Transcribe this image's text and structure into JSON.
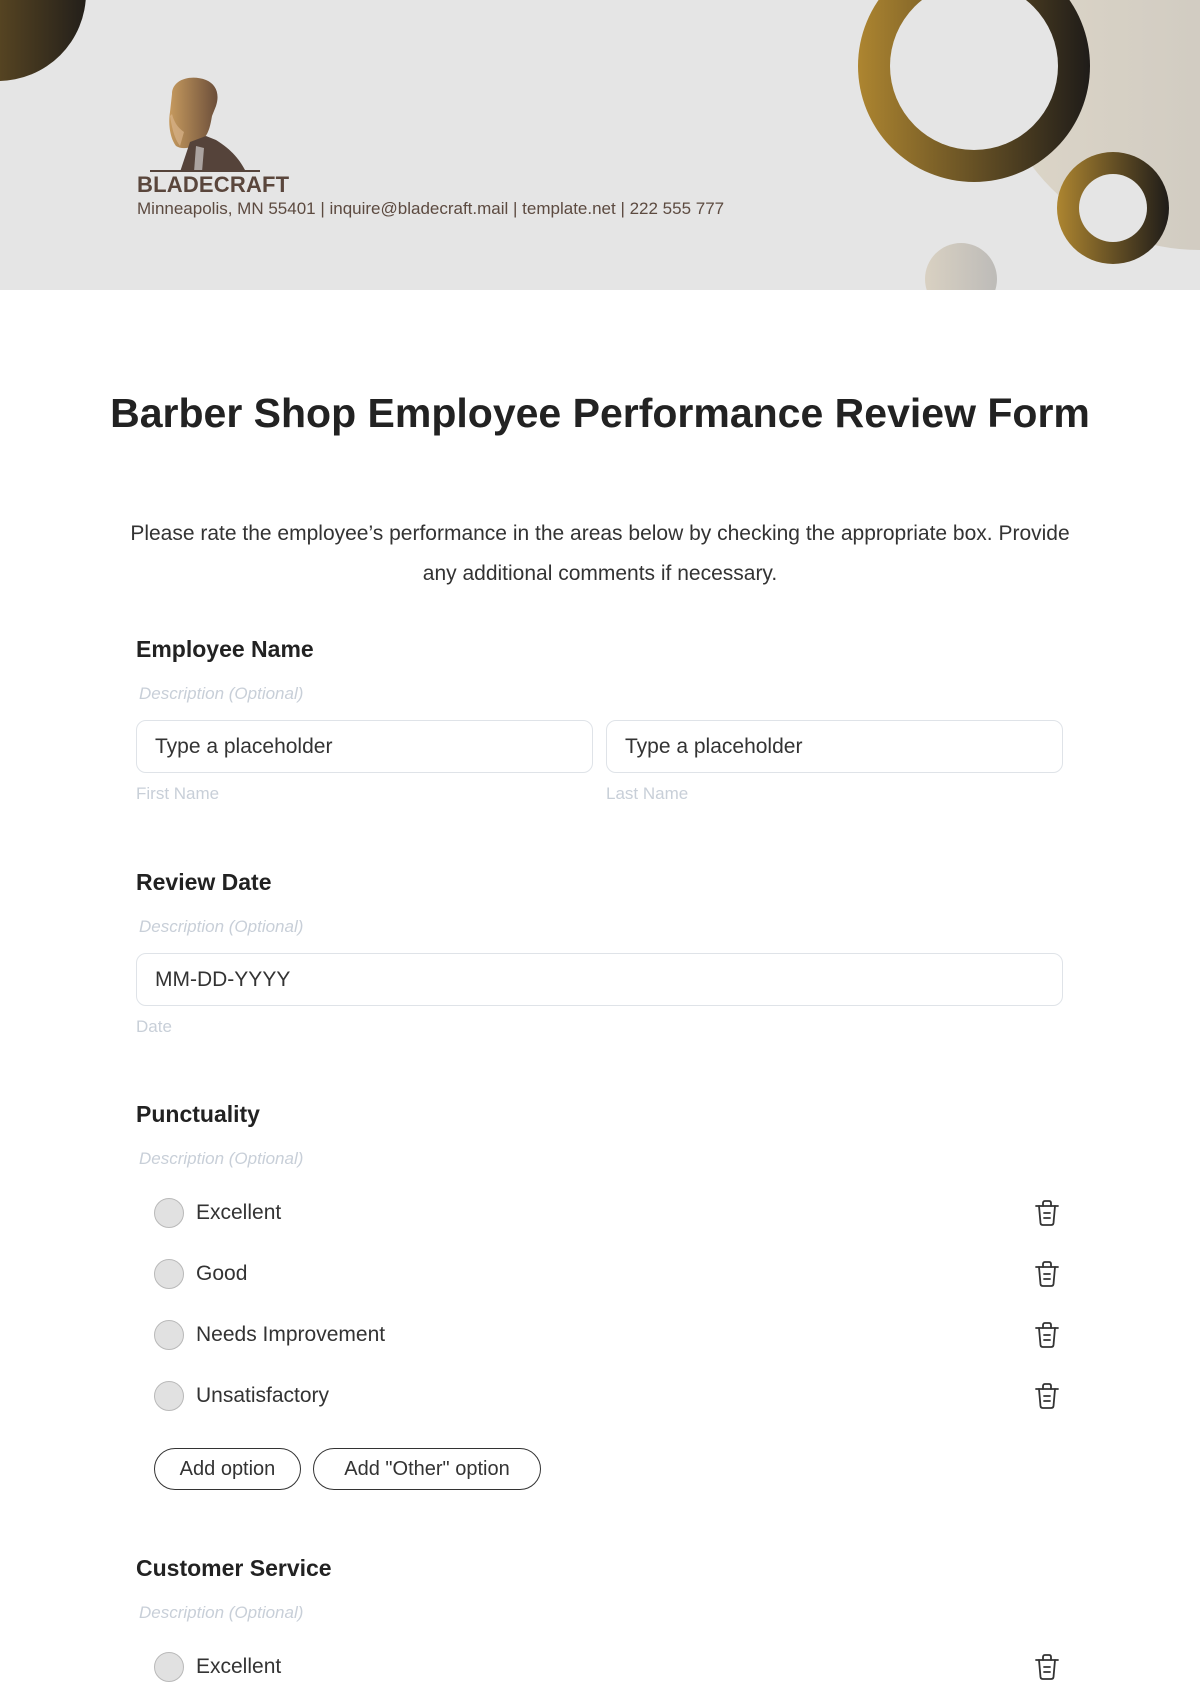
{
  "header": {
    "brand": "BLADECRAFT",
    "contact": "Minneapolis, MN 55401 | inquire@bladecraft.mail | template.net | 222 555 777",
    "logo_icon": "bearded-man-logo-icon",
    "colors": {
      "gold": "#ad8530",
      "dark": "#1f1c19",
      "brand_text": "#5a463c",
      "header_bg": "#e5e5e5"
    }
  },
  "form": {
    "title": "Barber Shop Employee Performance Review Form",
    "intro": "Please rate the employee’s performance in the areas below by checking the appropriate box. Provide any additional comments if necessary.",
    "employee_name": {
      "label": "Employee Name",
      "description": "Description (Optional)",
      "first": {
        "placeholder": "Type a placeholder",
        "sublabel": "First Name"
      },
      "last": {
        "placeholder": "Type a placeholder",
        "sublabel": "Last Name"
      }
    },
    "review_date": {
      "label": "Review Date",
      "description": "Description (Optional)",
      "placeholder": "MM-DD-YYYY",
      "sublabel": "Date"
    },
    "punctuality": {
      "label": "Punctuality",
      "description": "Description (Optional)",
      "options": [
        "Excellent",
        "Good",
        "Needs Improvement",
        "Unsatisfactory"
      ],
      "add_option": "Add option",
      "add_other_option": "Add \"Other\" option"
    },
    "customer_service": {
      "label": "Customer Service",
      "description": "Description (Optional)",
      "options": [
        "Excellent"
      ]
    }
  }
}
